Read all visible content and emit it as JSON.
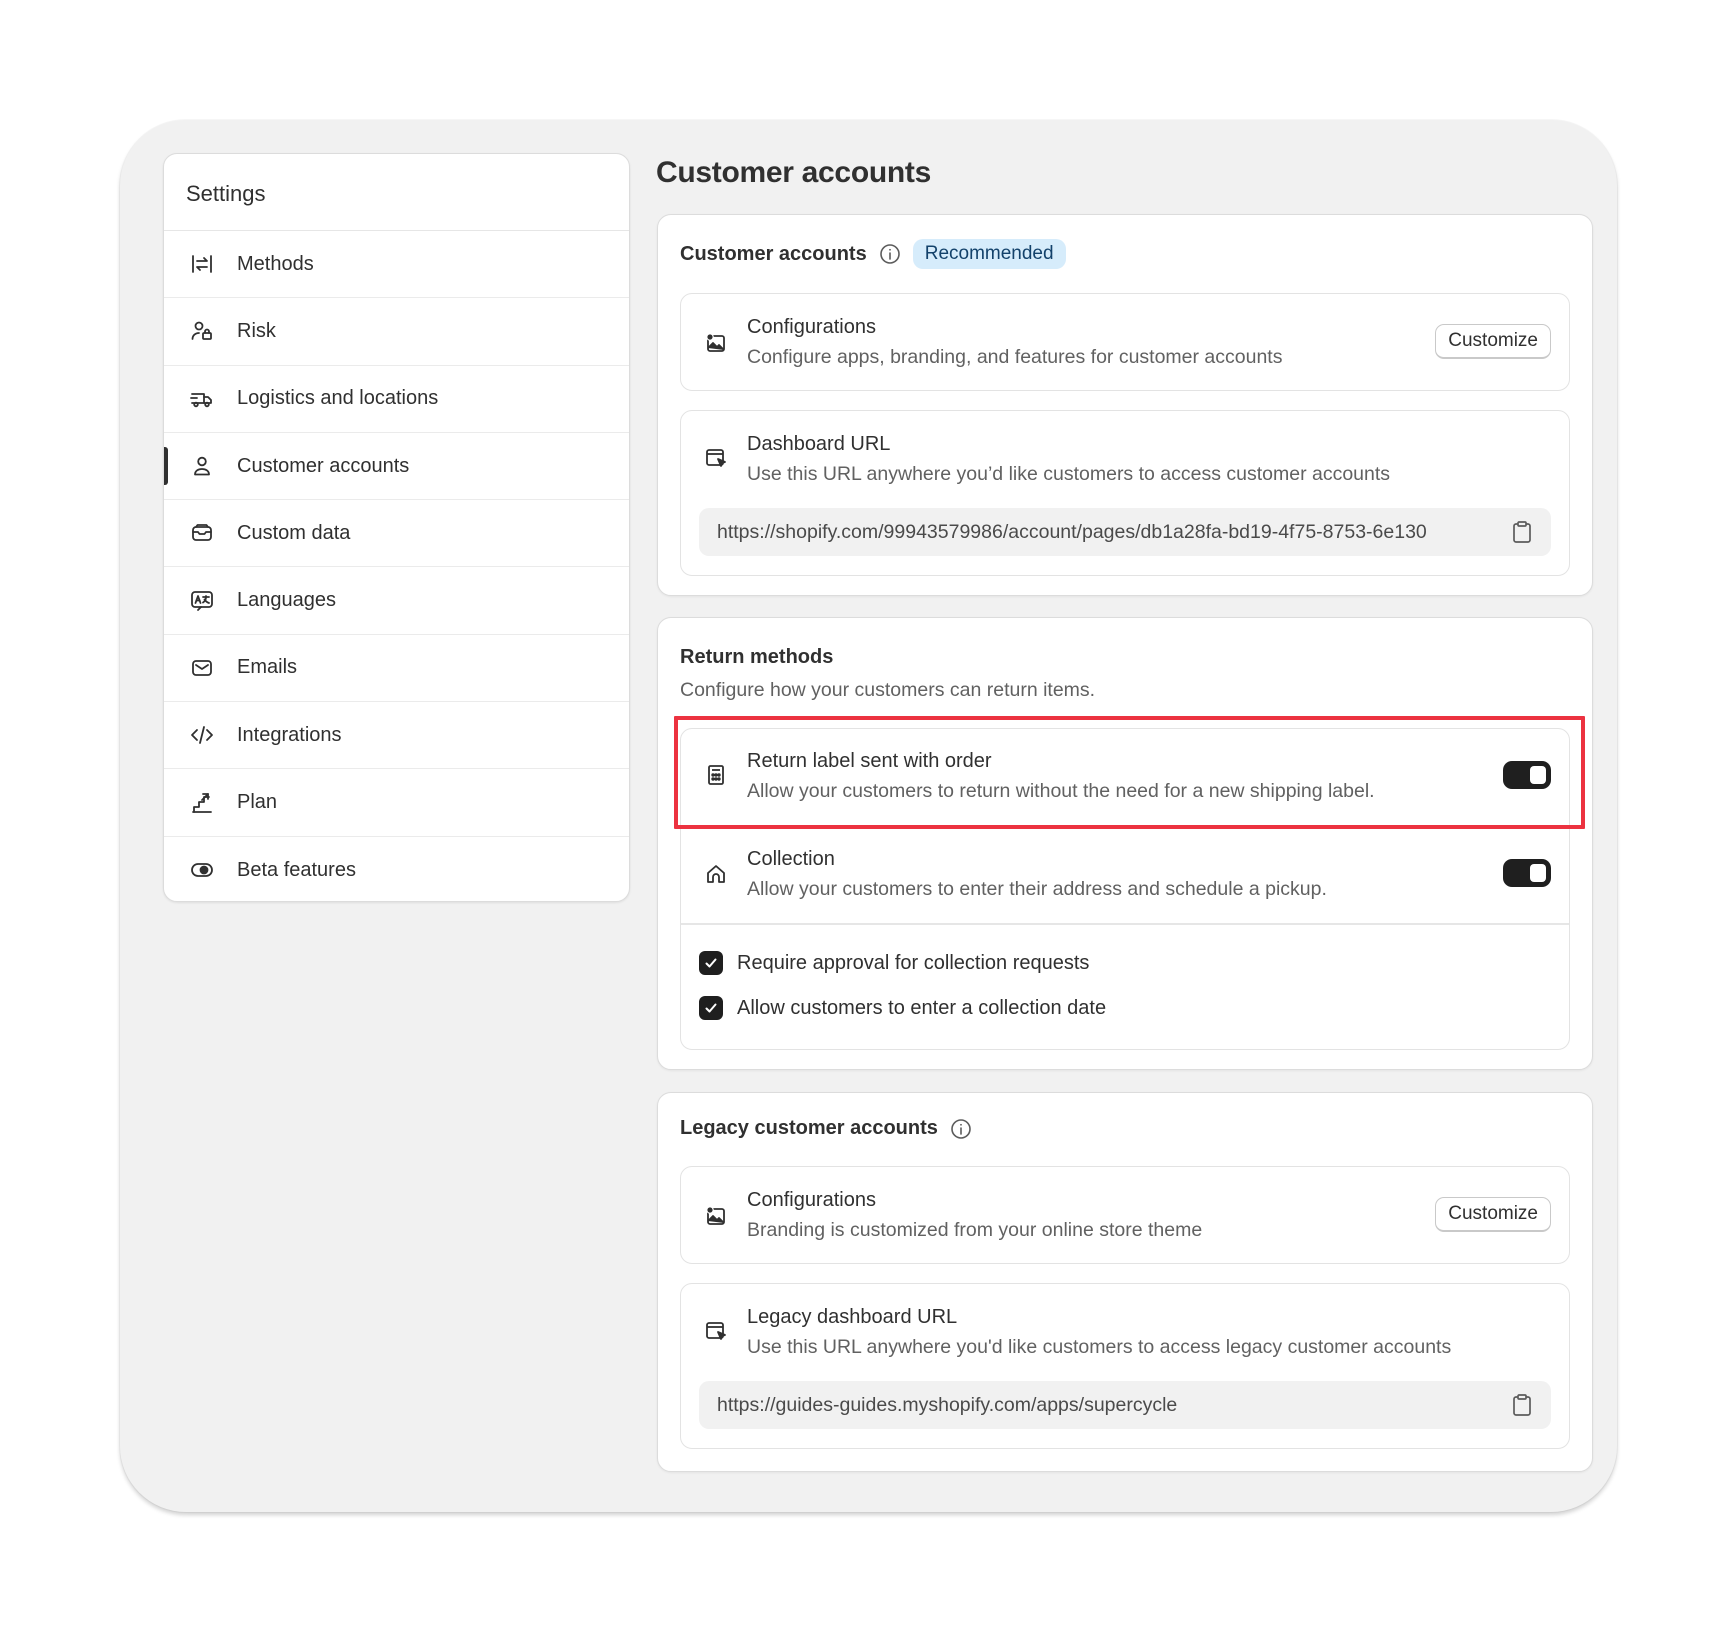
{
  "sidebar": {
    "title": "Settings",
    "items": [
      {
        "label": "Methods",
        "icon": "arrows-exchange-icon"
      },
      {
        "label": "Risk",
        "icon": "person-lock-icon"
      },
      {
        "label": "Logistics and locations",
        "icon": "delivery-truck-icon"
      },
      {
        "label": "Customer accounts",
        "icon": "person-icon",
        "active": true
      },
      {
        "label": "Custom data",
        "icon": "box-icon"
      },
      {
        "label": "Languages",
        "icon": "translate-icon"
      },
      {
        "label": "Emails",
        "icon": "envelope-icon"
      },
      {
        "label": "Integrations",
        "icon": "code-icon"
      },
      {
        "label": "Plan",
        "icon": "stairs-icon"
      },
      {
        "label": "Beta features",
        "icon": "toggle-eye-icon"
      }
    ]
  },
  "page": {
    "title": "Customer accounts"
  },
  "customer_accounts": {
    "heading": "Customer accounts",
    "badge": "Recommended",
    "configurations": {
      "title": "Configurations",
      "description": "Configure apps, branding, and features for customer accounts",
      "button": "Customize"
    },
    "dashboard": {
      "title": "Dashboard URL",
      "description": "Use this URL anywhere you’d like customers to access customer accounts",
      "url": "https://shopify.com/99943579986/account/pages/db1a28fa-bd19-4f75-8753-6e130"
    }
  },
  "return_methods": {
    "heading": "Return methods",
    "description": "Configure how your customers can return items.",
    "return_label": {
      "title": "Return label sent with order",
      "description": "Allow your customers to return without the need for a new shipping label.",
      "enabled": true
    },
    "collection": {
      "title": "Collection",
      "description": "Allow your customers to enter their address and schedule a pickup.",
      "enabled": true
    },
    "options": [
      {
        "label": "Require approval for collection requests",
        "checked": true
      },
      {
        "label": "Allow customers to enter a collection date",
        "checked": true
      }
    ]
  },
  "legacy": {
    "heading": "Legacy customer accounts",
    "configurations": {
      "title": "Configurations",
      "description": "Branding is customized from your online store theme",
      "button": "Customize"
    },
    "dashboard": {
      "title": "Legacy dashboard URL",
      "description": "Use this URL anywhere you'd like customers to access legacy customer accounts",
      "url": "https://guides-guides.myshopify.com/apps/supercycle"
    }
  },
  "colors": {
    "accent": "#1f1f1f",
    "highlight": "#ec3240",
    "badge_bg": "#d6ecfb",
    "frame_bg": "#f1f1f1"
  }
}
